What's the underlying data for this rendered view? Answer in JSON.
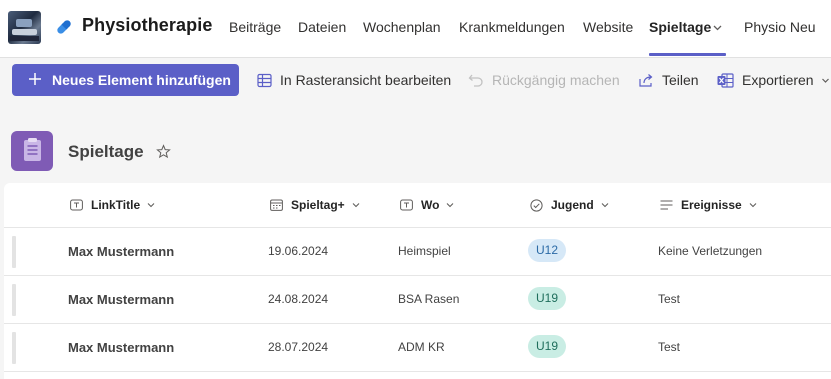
{
  "site": {
    "title": "Physiotherapie"
  },
  "nav": {
    "items": [
      {
        "label": "Beiträge"
      },
      {
        "label": "Dateien"
      },
      {
        "label": "Wochenplan"
      },
      {
        "label": "Krankmeldungen"
      },
      {
        "label": "Website"
      },
      {
        "label": "Spieltage"
      },
      {
        "label": "Physio Neu"
      }
    ]
  },
  "commands": {
    "new_label": "Neues Element hinzufügen",
    "grid_label": "In Rasteransicht bearbeiten",
    "undo_label": "Rückgängig machen",
    "share_label": "Teilen",
    "export_label": "Exportieren"
  },
  "list": {
    "title": "Spieltage",
    "columns": [
      {
        "label": "LinkTitle",
        "icon": "text-field-icon"
      },
      {
        "label": "Spieltag+",
        "icon": "calendar-icon"
      },
      {
        "label": "Wo",
        "icon": "text-field-icon"
      },
      {
        "label": "Jugend",
        "icon": "choice-check-icon"
      },
      {
        "label": "Ereignisse",
        "icon": "multiline-text-icon"
      }
    ],
    "rows": [
      {
        "title": "Max Mustermann",
        "date": "19.06.2024",
        "wo": "Heimspiel",
        "jugend": "U12",
        "ereignisse": "Keine Verletzungen"
      },
      {
        "title": "Max Mustermann",
        "date": "24.08.2024",
        "wo": "BSA Rasen",
        "jugend": "U19",
        "ereignisse": "Test"
      },
      {
        "title": "Max Mustermann",
        "date": "28.07.2024",
        "wo": "ADM KR",
        "jugend": "U19",
        "ereignisse": "Test"
      }
    ]
  },
  "colors": {
    "accent": "#5b5fc7",
    "list_icon": "#7f5bb5",
    "badge_u12_bg": "#d6e8f7",
    "badge_u12_fg": "#2b6aa6",
    "badge_u19_bg": "#c9ede4",
    "badge_u19_fg": "#1f6e5c"
  }
}
